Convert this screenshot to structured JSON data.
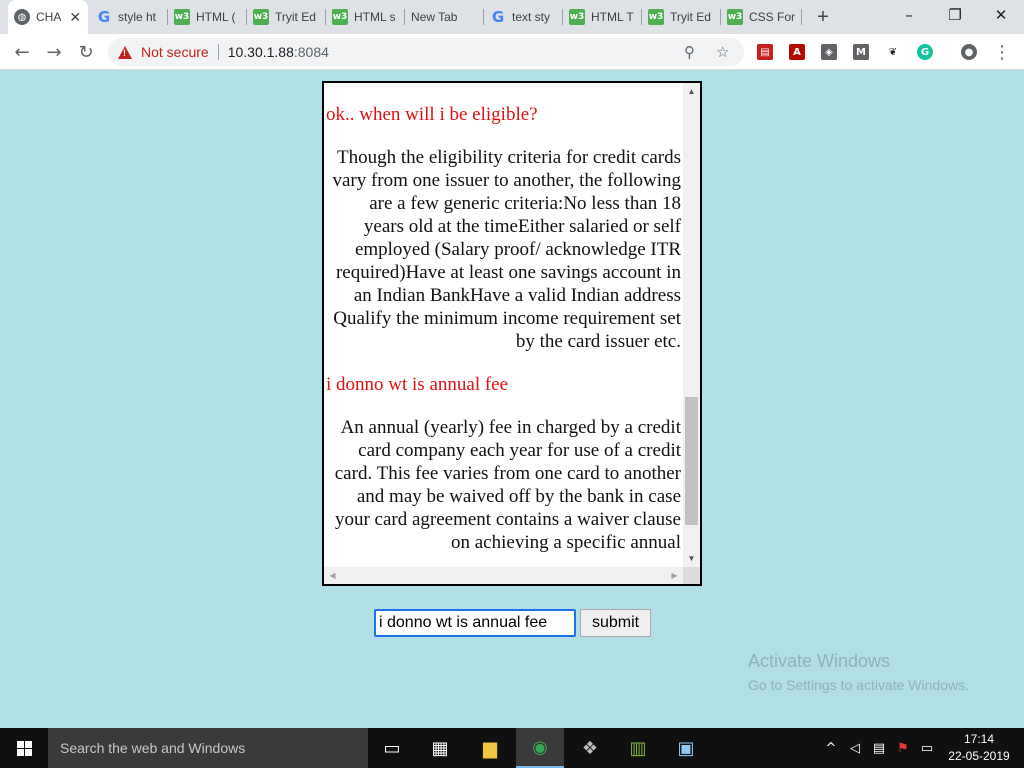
{
  "tabs": [
    {
      "title": "CHA",
      "icon": "globe-icon",
      "active": true
    },
    {
      "title": "style ht",
      "icon": "google-icon"
    },
    {
      "title": "HTML (",
      "icon": "w3schools-icon"
    },
    {
      "title": "Tryit Ed",
      "icon": "w3schools-icon"
    },
    {
      "title": "HTML s",
      "icon": "w3schools-icon"
    },
    {
      "title": "New Tab",
      "icon": ""
    },
    {
      "title": "text sty",
      "icon": "google-icon"
    },
    {
      "title": "HTML T",
      "icon": "w3schools-icon"
    },
    {
      "title": "Tryit Ed",
      "icon": "w3schools-icon"
    },
    {
      "title": "CSS For",
      "icon": "w3schools-icon"
    }
  ],
  "window_controls": {
    "minimize": "–",
    "restore": "❐",
    "close": "✕"
  },
  "address_bar": {
    "security_label": "Not secure",
    "url_host": "10.30.1.88",
    "url_port": ":8084"
  },
  "chat": {
    "messages": [
      {
        "from": "user",
        "text": "ok.. when will i be eligible?"
      },
      {
        "from": "bot",
        "text": "Though the eligibility criteria for credit cards vary from one issuer to another, the following are a few generic criteria:No less than 18 years old at the timeEither salaried or self employed (Salary proof/ acknowledge ITR required)Have at least one savings account in an Indian BankHave a valid Indian address Qualify the minimum income requirement set by the card issuer etc."
      },
      {
        "from": "user",
        "text": "i donno wt is annual fee"
      },
      {
        "from": "bot",
        "text": "An annual (yearly) fee in charged by a credit card company each year for use of a credit card. This fee varies from one card to another and may be waived off by the bank in case your card agreement contains a waiver clause on achieving a specific annual"
      }
    ],
    "input_value": "i donno wt is annual fee",
    "submit_label": "submit"
  },
  "watermark": {
    "title": "Activate Windows",
    "subtitle": "Go to Settings to activate Windows."
  },
  "taskbar": {
    "search_placeholder": "Search the web and Windows",
    "time": "17:14",
    "date": "22-05-2019"
  },
  "colors": {
    "page_background": "#b0dfe6",
    "user_message": "#e01010",
    "bot_message": "#111111",
    "insecure_red": "#c5221f"
  }
}
